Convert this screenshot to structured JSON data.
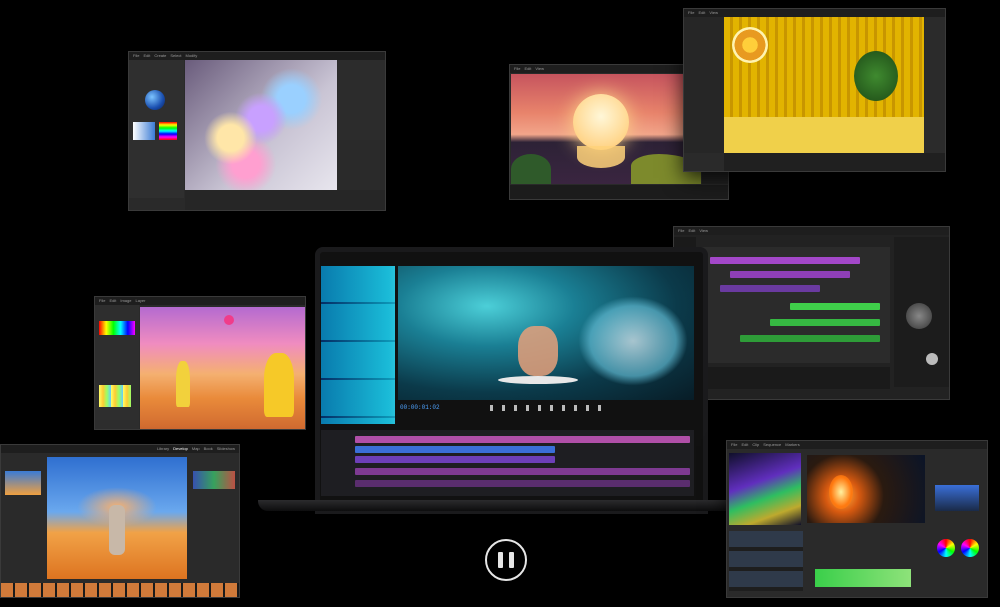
{
  "scene": {
    "title": ""
  },
  "player": {
    "state": "playing",
    "control_label": "Pause"
  },
  "video_editor": {
    "timecode": "00:00:01:02"
  },
  "apps": [
    {
      "name": "3d-render-app",
      "menus": [
        "File",
        "Edit",
        "Create",
        "Select",
        "Modify",
        "Mesh",
        "Window",
        "Help"
      ]
    },
    {
      "name": "compositing-app",
      "menus": [
        "File",
        "Edit",
        "View",
        "Layer",
        "Render"
      ]
    },
    {
      "name": "3d-interior-app",
      "menus": [
        "File",
        "Edit",
        "View",
        "Render",
        "Window"
      ]
    },
    {
      "name": "photo-editor-app",
      "menus": [
        "File",
        "Edit",
        "Image",
        "Layer",
        "Type",
        "Select",
        "Filter",
        "View"
      ]
    },
    {
      "name": "music-daw-app",
      "menus": [
        "File",
        "Edit",
        "View",
        "Track",
        "Mix"
      ]
    },
    {
      "name": "photo-library-app",
      "tabs": [
        "Library",
        "Develop",
        "Map",
        "Book",
        "Slideshow",
        "Print",
        "Web"
      ]
    },
    {
      "name": "color-grading-app",
      "menus": [
        "File",
        "Edit",
        "Clip",
        "Sequence",
        "Markers",
        "Graphics",
        "View",
        "Window",
        "Help"
      ]
    }
  ]
}
